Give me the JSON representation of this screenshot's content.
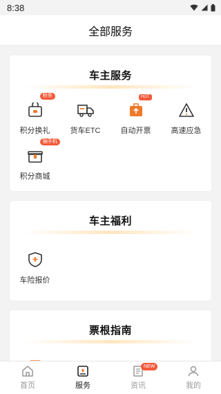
{
  "status": {
    "time": "8:38"
  },
  "header": {
    "title": "全部服务"
  },
  "sections": [
    {
      "title": "车主服务",
      "items": [
        {
          "label": "积分换礼",
          "icon": "gift-basket-icon",
          "badge": "秒杀"
        },
        {
          "label": "货车ETC",
          "icon": "truck-icon",
          "badge": ""
        },
        {
          "label": "自动开票",
          "icon": "invoice-icon",
          "badge": "HOT"
        },
        {
          "label": "高速应急",
          "icon": "warning-triangle-icon",
          "badge": ""
        },
        {
          "label": "积分商城",
          "icon": "gift-box-icon",
          "badge": "抽手机"
        }
      ]
    },
    {
      "title": "车主福利",
      "items": [
        {
          "label": "车险报价",
          "icon": "shield-plus-icon",
          "badge": ""
        }
      ]
    },
    {
      "title": "票根指南",
      "items": [
        {
          "label": "",
          "icon": "ticket-doc-icon"
        },
        {
          "label": "",
          "icon": "route-pin-icon"
        },
        {
          "label": "",
          "icon": "book-icon"
        },
        {
          "label": "",
          "icon": "bell-icon"
        }
      ]
    }
  ],
  "tabbar": {
    "tabs": [
      {
        "label": "首页",
        "icon": "home-icon"
      },
      {
        "label": "服务",
        "icon": "service-icon"
      },
      {
        "label": "资讯",
        "icon": "news-icon",
        "badge": "NEW"
      },
      {
        "label": "我的",
        "icon": "profile-icon"
      }
    ],
    "active": "服务"
  },
  "colors": {
    "accent": "#f07a2a",
    "badge": "#f35a3a",
    "divider": "#ffe6c0"
  }
}
